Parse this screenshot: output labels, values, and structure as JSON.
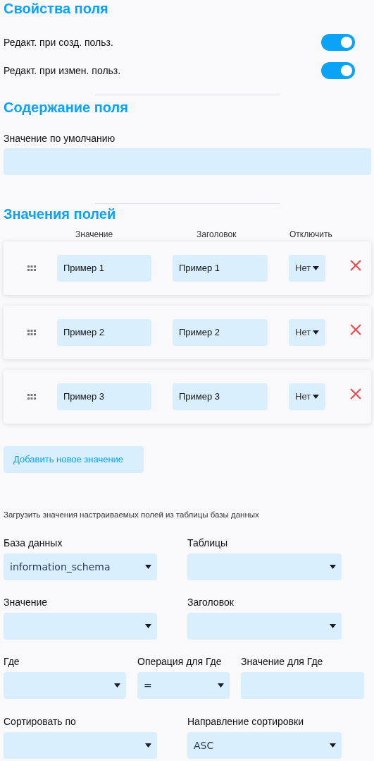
{
  "heading": "Свойства поля",
  "toggles": [
    {
      "label": "Редакт. при созд. польз.",
      "on": true
    },
    {
      "label": "Редакт. при измен. польз.",
      "on": true
    }
  ],
  "content_heading": "Содержание поля",
  "default_value": {
    "label": "Значение по умолчанию"
  },
  "values_heading": "Значения полей",
  "columns": [
    "Значение",
    "Заголовок",
    "Отключить"
  ],
  "rows": [
    {
      "value": "Пример 1",
      "title": "Пример 1",
      "disable": "Нет"
    },
    {
      "value": "Пример 2",
      "title": "Пример 2",
      "disable": "Нет"
    },
    {
      "value": "Пример 3",
      "title": "Пример 3",
      "disable": "Нет"
    }
  ],
  "add_button": "Добавить новое значение",
  "load_note": "Загрузить значения настраиваемых полей из таблицы базы данных",
  "db_rows": [
    [
      {
        "label": "База данных",
        "kind": "select",
        "value": "information_schema"
      },
      {
        "label": "Таблицы",
        "kind": "select"
      }
    ],
    [
      {
        "label": "Значение",
        "kind": "select"
      },
      {
        "label": "Заголовок",
        "kind": "select"
      }
    ],
    [
      {
        "label": "Где",
        "kind": "select"
      },
      {
        "label": "Операция для Где",
        "kind": "select",
        "value": "="
      },
      {
        "label": "Значение для Где",
        "kind": "input"
      }
    ],
    [
      {
        "label": "Сортировать по",
        "kind": "select"
      },
      {
        "label": "Направление сортировки",
        "kind": "select",
        "value": "ASC"
      }
    ]
  ]
}
